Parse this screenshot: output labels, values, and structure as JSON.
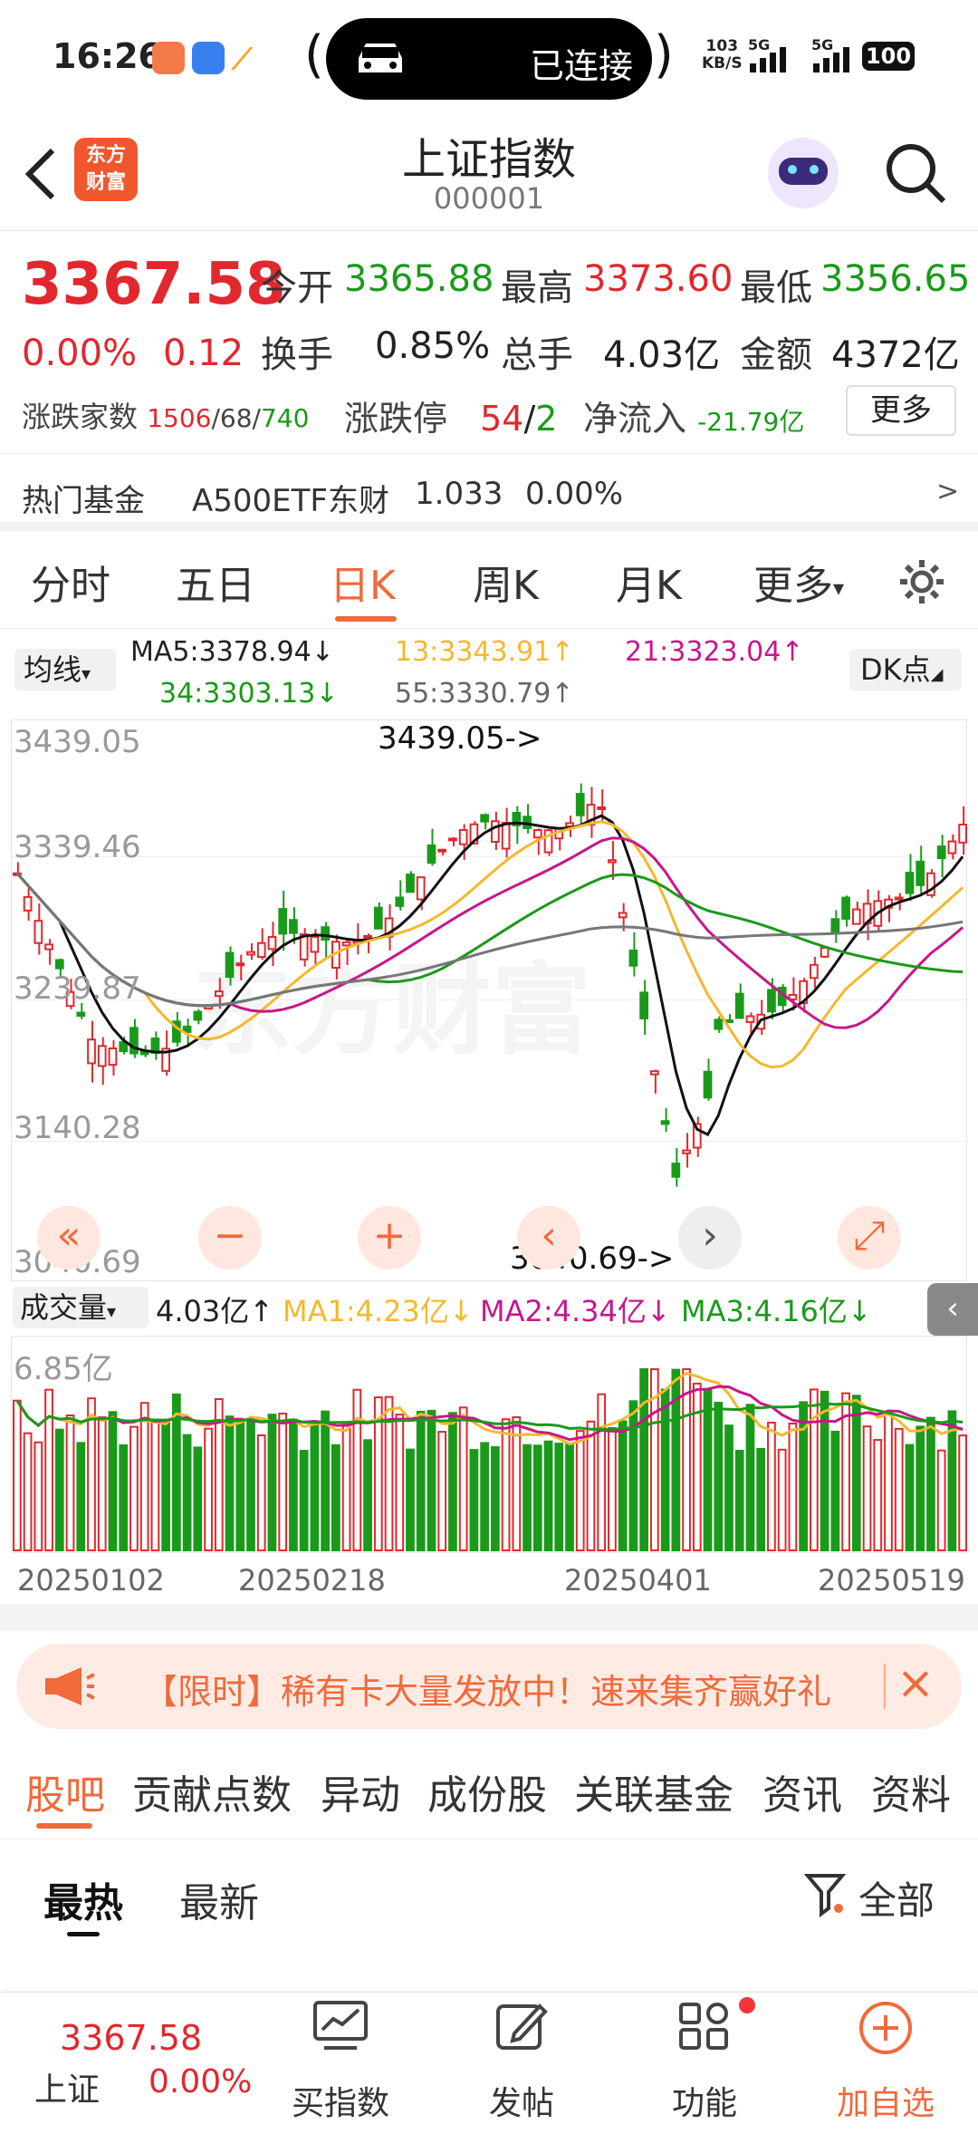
{
  "status_bar": {
    "time": "16:26",
    "connection_label": "已连接",
    "net_speed_top": "103",
    "net_speed_bottom": "KB/S",
    "signal1": "5G",
    "signal2": "5G",
    "battery": "100"
  },
  "header": {
    "logo_line1": "东方",
    "logo_line2": "财富",
    "title": "上证指数",
    "code": "000001"
  },
  "quote": {
    "price": "3367.58",
    "change_pct": "0.00%",
    "change": "0.12",
    "open_label": "今开",
    "open": "3365.88",
    "high_label": "最高",
    "high": "3373.60",
    "low_label": "最低",
    "low": "3356.65",
    "turnover_label": "换手",
    "turnover": "0.85%",
    "volume_label": "总手",
    "volume": "4.03亿",
    "amount_label": "金额",
    "amount": "4372亿",
    "breadth_label": "涨跌家数",
    "breadth_up": "1506",
    "breadth_sep1": "/",
    "breadth_flat": "68",
    "breadth_sep2": "/",
    "breadth_down": "740",
    "limit_label": "涨跌停",
    "limit_up": "54",
    "limit_sep": "/",
    "limit_down": "2",
    "netflow_label": "净流入",
    "netflow": "-21.79亿",
    "more_label": "更多"
  },
  "hot_fund": {
    "label": "热门基金",
    "name": "A500ETF东财",
    "price": "1.033",
    "pct": "0.00%",
    "arrow": ">"
  },
  "period_tabs": [
    "分时",
    "五日",
    "日K",
    "周K",
    "月K",
    "更多"
  ],
  "active_tab_index": 2,
  "ma_bar": {
    "selector": "均线",
    "ma5": "MA5:3378.94↓",
    "ma13": "13:3343.91↑",
    "ma21": "21:3323.04↑",
    "ma34": "34:3303.13↓",
    "ma55": "55:3330.79↑",
    "dk_button": "DK点"
  },
  "chart_data": {
    "type": "candlestick",
    "y_axis_labels": [
      "3439.05",
      "3339.46",
      "3239.87",
      "3140.28",
      "3040.69"
    ],
    "ylim": [
      3040.69,
      3439.05
    ],
    "annotations": [
      "3439.05->",
      "3040.69->"
    ],
    "watermark": "东方财富",
    "x_labels": [
      "20250102",
      "20250218",
      "20250401",
      "20250519"
    ],
    "volume": {
      "selector": "成交量",
      "value": "4.03亿↑",
      "ma1": "MA1:4.23亿↓",
      "ma2": "MA2:4.34亿↓",
      "ma3": "MA3:4.16亿↓",
      "max_label": "6.85亿"
    }
  },
  "colors": {
    "up": "#e0282e",
    "down": "#1a9a1a",
    "accent": "#f06a3a",
    "ma5": "#111111",
    "ma13": "#f5b82e",
    "ma21": "#c8168a",
    "ma34": "#1a9a1a",
    "ma55": "#777777"
  },
  "promo": {
    "text": "【限时】稀有卡大量发放中！速来集齐赢好礼"
  },
  "section_tabs": [
    "股吧",
    "贡献点数",
    "异动",
    "成份股",
    "关联基金",
    "资讯",
    "资料"
  ],
  "feed_tabs": {
    "hot": "最热",
    "latest": "最新",
    "filter": "全部"
  },
  "bottom_bar": {
    "price": "3367.58",
    "name": "上证",
    "pct": "0.00%",
    "items": [
      "买指数",
      "发帖",
      "功能",
      "加自选"
    ]
  }
}
